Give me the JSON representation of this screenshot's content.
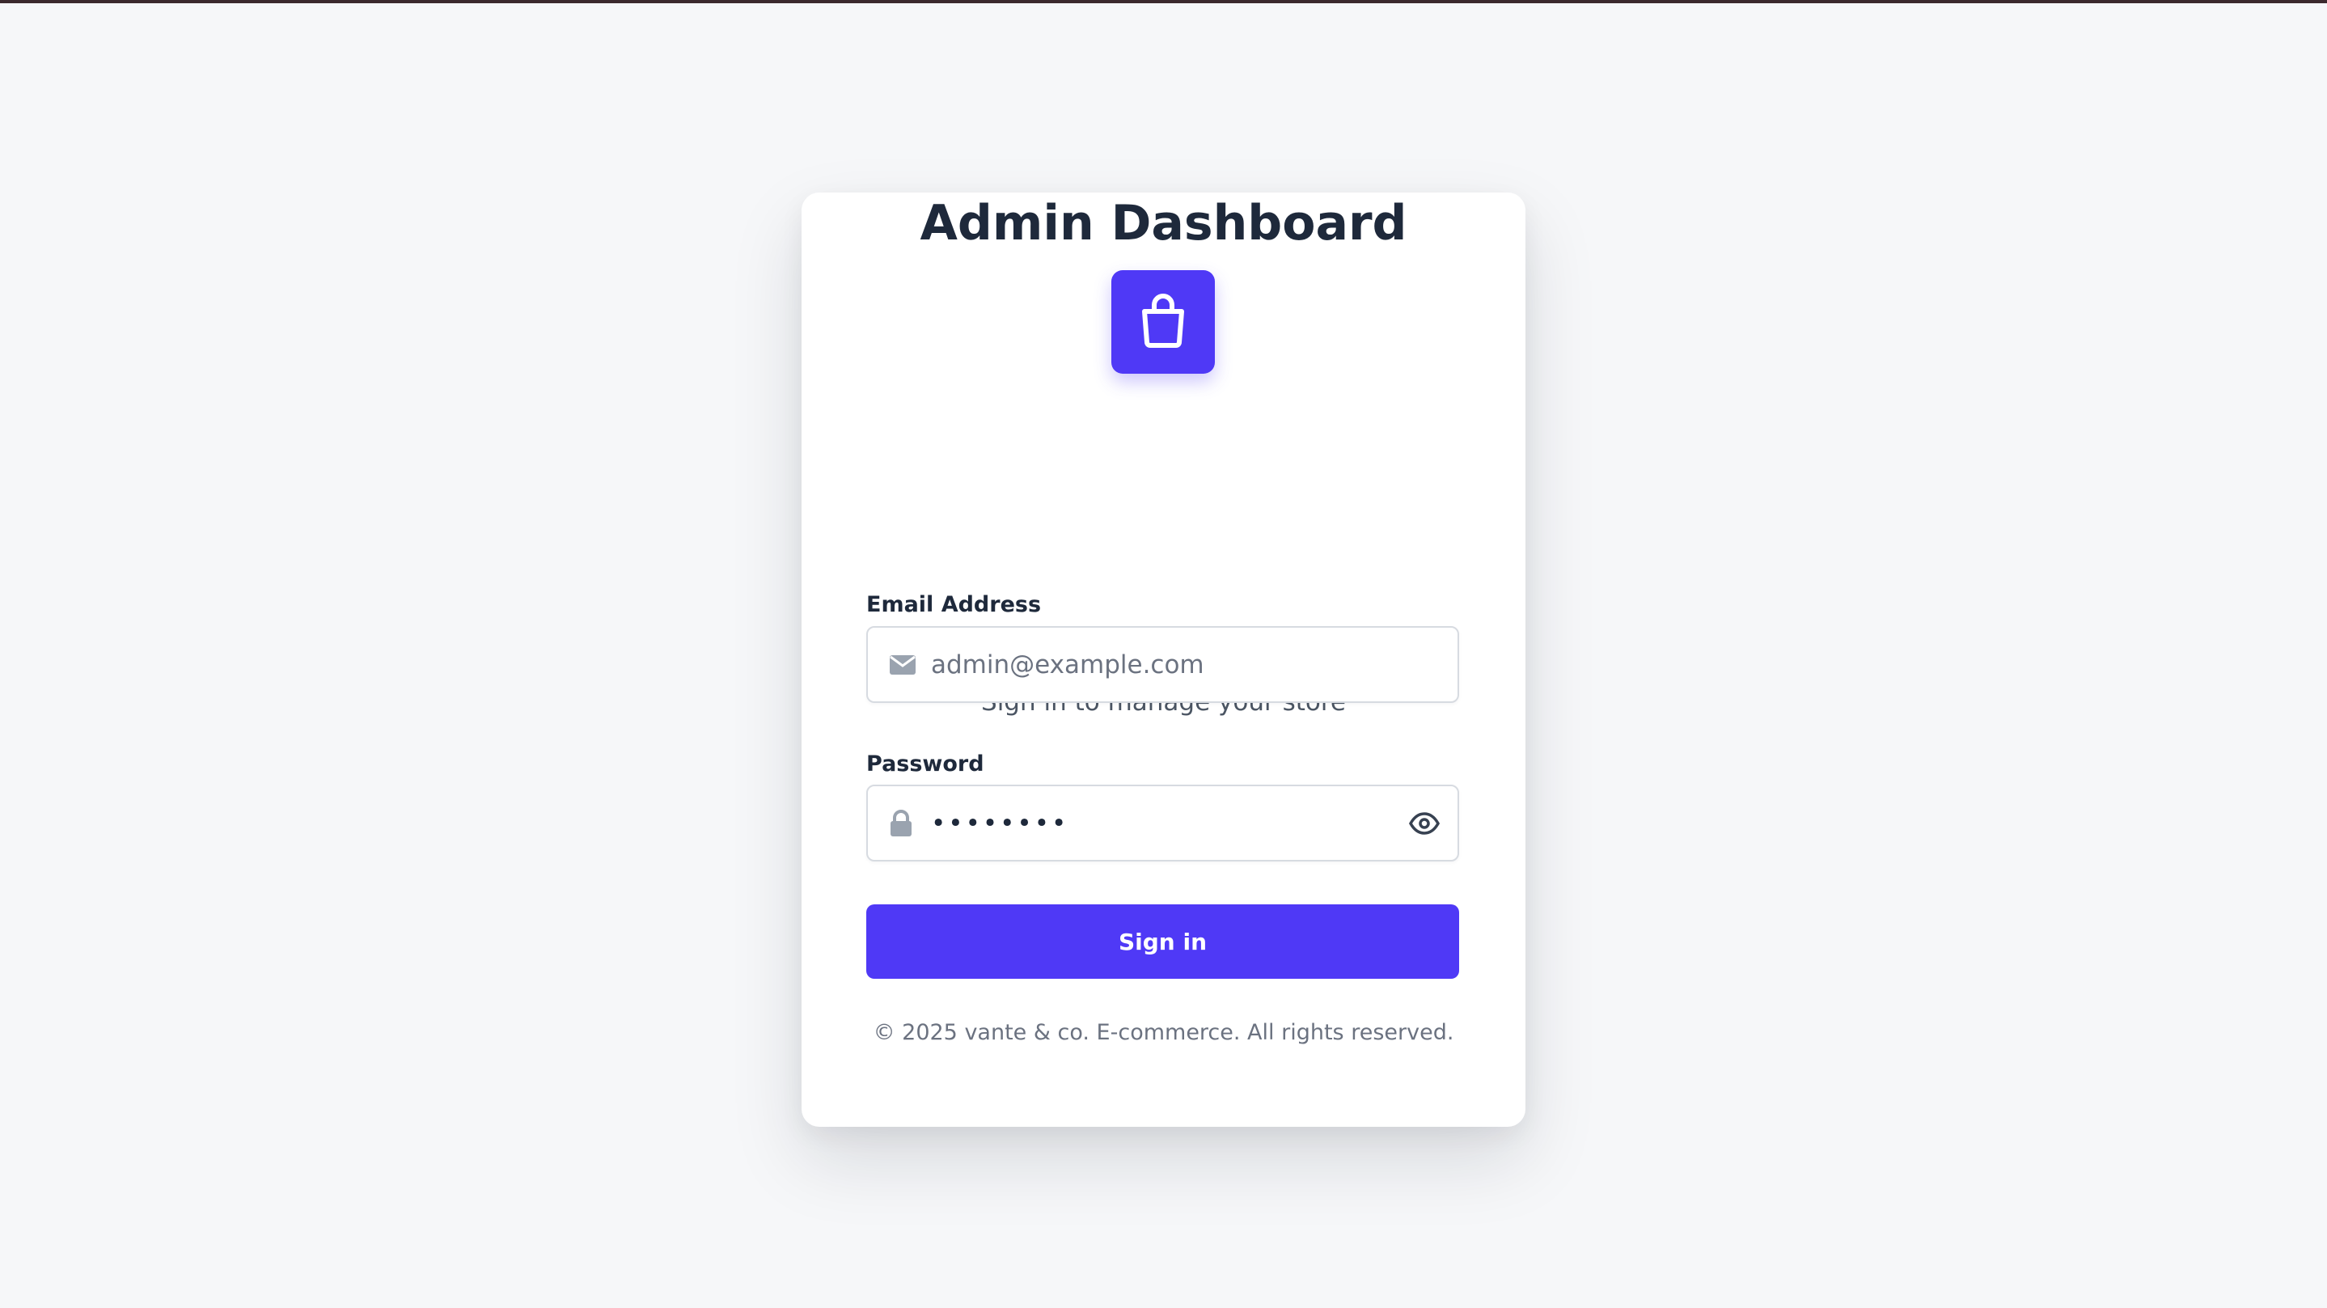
{
  "colors": {
    "accent": "#4f39f6",
    "title": "#1e293b",
    "muted": "#6b7280",
    "page_background": "#f6f7f9"
  },
  "logo": {
    "icon": "shopping-bag-icon"
  },
  "header": {
    "title": "Admin Dashboard",
    "subtitle": "Sign in to manage your store"
  },
  "form": {
    "email": {
      "label": "Email Address",
      "placeholder": "admin@example.com",
      "value": "",
      "icon": "envelope-icon"
    },
    "password": {
      "label": "Password",
      "value": "••••••••",
      "icon": "lock-icon",
      "toggle_icon": "eye-icon"
    },
    "submit_label": "Sign in"
  },
  "footer": {
    "text": "© 2025 vante & co. E-commerce. All rights reserved."
  }
}
